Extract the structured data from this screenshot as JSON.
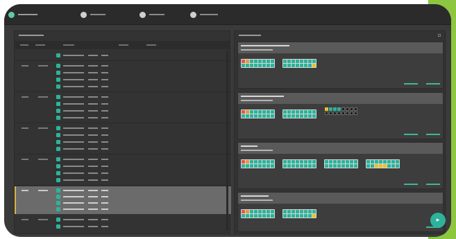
{
  "colors": {
    "accent": "#2db39a",
    "frame": "#3a3a3a",
    "topbar": "#2b2b2b",
    "highlight": "#6b6b6b",
    "edge": "#8dc63f"
  },
  "topbar": {
    "tabs": [
      {
        "icon": "circle-icon",
        "active": true
      },
      {
        "icon": "circle-icon",
        "active": false
      },
      {
        "icon": "circle-icon",
        "active": false
      },
      {
        "icon": "circle-icon",
        "active": false
      }
    ]
  },
  "icons": {
    "fab": "play-arrow-icon"
  }
}
